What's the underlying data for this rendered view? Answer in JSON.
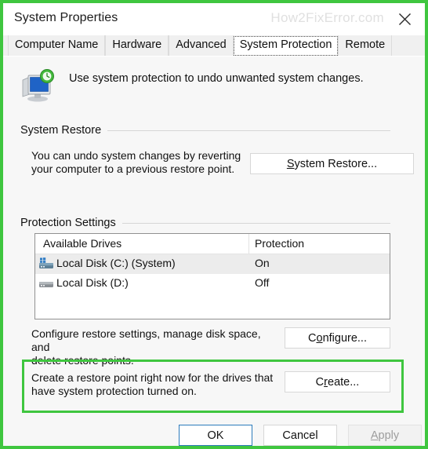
{
  "window": {
    "title": "System Properties",
    "watermark": "How2FixError.com",
    "close_icon": "close-icon",
    "accent_green": "#3fc63f",
    "default_button_border": "#2c7bbb"
  },
  "tabs": [
    {
      "label": "Computer Name",
      "active": false
    },
    {
      "label": "Hardware",
      "active": false
    },
    {
      "label": "Advanced",
      "active": false
    },
    {
      "label": "System Protection",
      "active": true
    },
    {
      "label": "Remote",
      "active": false
    }
  ],
  "header": {
    "icon": "system-restore-icon",
    "description": "Use system protection to undo unwanted system changes."
  },
  "system_restore": {
    "group_label": "System Restore",
    "description_line1": "You can undo system changes by reverting",
    "description_line2": "your computer to a previous restore point.",
    "button": {
      "accel": "S",
      "rest": "ystem Restore..."
    }
  },
  "protection_settings": {
    "group_label": "Protection Settings",
    "table": {
      "columns": [
        "Available Drives",
        "Protection"
      ],
      "rows": [
        {
          "icon": "system-drive-icon",
          "name": "Local Disk (C:) (System)",
          "protection": "On",
          "selected": true
        },
        {
          "icon": "drive-icon",
          "name": "Local Disk (D:)",
          "protection": "Off",
          "selected": false
        }
      ]
    },
    "configure": {
      "description_line1": "Configure restore settings, manage disk space, and",
      "description_line2": "delete restore points.",
      "button": {
        "pre": "C",
        "accel": "o",
        "rest": "nfigure..."
      }
    },
    "create": {
      "description_line1": "Create a restore point right now for the drives that",
      "description_line2": "have system protection turned on.",
      "button": {
        "pre": "C",
        "accel": "r",
        "rest": "eate..."
      },
      "highlighted": true
    }
  },
  "footer": {
    "ok": "OK",
    "cancel": "Cancel",
    "apply": {
      "accel": "A",
      "rest": "pply",
      "disabled": true
    }
  }
}
